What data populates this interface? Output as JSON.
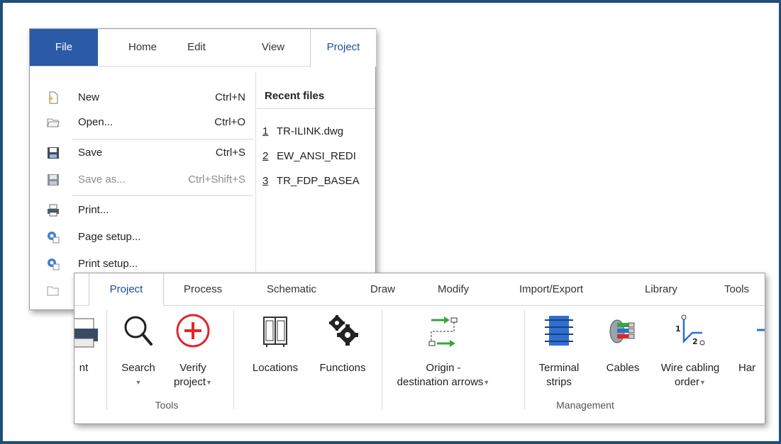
{
  "file_menu": {
    "tabs": [
      {
        "label": "File"
      },
      {
        "label": "Home"
      },
      {
        "label": "Edit"
      },
      {
        "label": "View"
      },
      {
        "label": "Project"
      }
    ],
    "items": [
      {
        "label": "New",
        "shortcut": "Ctrl+N",
        "icon": "new-file-icon",
        "enabled": true
      },
      {
        "label": "Open...",
        "shortcut": "Ctrl+O",
        "icon": "open-folder-icon",
        "enabled": true
      },
      {
        "label": "Save",
        "shortcut": "Ctrl+S",
        "icon": "save-icon",
        "enabled": true
      },
      {
        "label": "Save as...",
        "shortcut": "Ctrl+Shift+S",
        "icon": "save-as-icon",
        "enabled": false
      },
      {
        "label": "Print...",
        "shortcut": "",
        "icon": "printer-icon",
        "enabled": true
      },
      {
        "label": "Page setup...",
        "shortcut": "",
        "icon": "page-setup-icon",
        "enabled": true
      },
      {
        "label": "Print setup...",
        "shortcut": "",
        "icon": "print-setup-icon",
        "enabled": true
      }
    ],
    "recent_title": "Recent files",
    "recent_files": [
      {
        "num": "1",
        "name": "TR-ILINK.dwg"
      },
      {
        "num": "2",
        "name": "EW_ANSI_REDI"
      },
      {
        "num": "3",
        "name": "TR_FDP_BASEA"
      }
    ]
  },
  "ribbon": {
    "tabs": [
      {
        "label": "Project",
        "active": true
      },
      {
        "label": "Process"
      },
      {
        "label": "Schematic"
      },
      {
        "label": "Draw"
      },
      {
        "label": "Modify"
      },
      {
        "label": "Import/Export"
      },
      {
        "label": "Library"
      },
      {
        "label": "Tools"
      }
    ],
    "buttons": {
      "print_partial": "nt",
      "search": "Search",
      "verify_line1": "Verify",
      "verify_line2": "project",
      "locations": "Locations",
      "functions": "Functions",
      "origin_line1": "Origin -",
      "origin_line2": "destination arrows",
      "terminal_line1": "Terminal",
      "terminal_line2": "strips",
      "cables": "Cables",
      "wire_line1": "Wire cabling",
      "wire_line2": "order",
      "harness_partial": "Har"
    },
    "groups": {
      "tools": "Tools",
      "management": "Management"
    },
    "colors": {
      "accent": "#2b5aa6",
      "verify_red": "#e0262b",
      "terminal_blue": "#2e6fd1",
      "arrow_green": "#3aa53a"
    }
  }
}
